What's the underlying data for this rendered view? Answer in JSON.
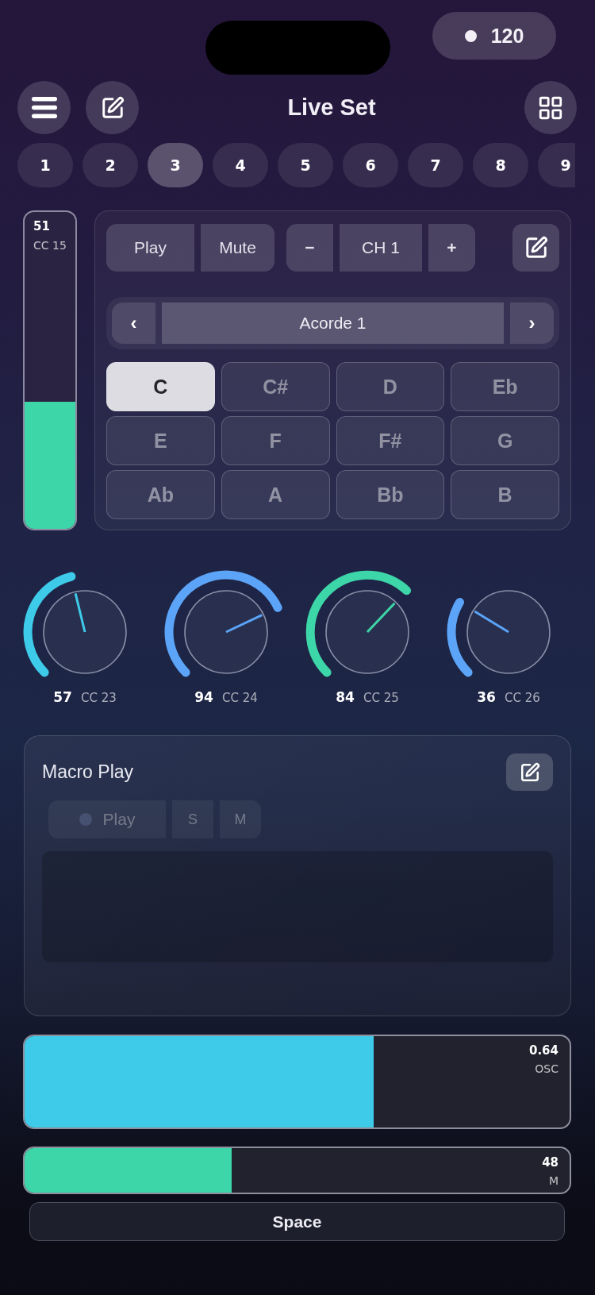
{
  "status_pill": {
    "text": "120"
  },
  "header": {
    "title": "Live Set"
  },
  "scene_tabs": [
    {
      "label": "1",
      "selected": false
    },
    {
      "label": "2",
      "selected": false
    },
    {
      "label": "3",
      "selected": true
    },
    {
      "label": "4",
      "selected": false
    },
    {
      "label": "5",
      "selected": false
    },
    {
      "label": "6",
      "selected": false
    },
    {
      "label": "7",
      "selected": false
    },
    {
      "label": "8",
      "selected": false
    },
    {
      "label": "9",
      "selected": false
    }
  ],
  "side_fader": {
    "value": "51",
    "label": "CC 15",
    "level": 0.4
  },
  "channel_panel": {
    "buttons": [
      {
        "label": "Play"
      },
      {
        "label": "Mute"
      }
    ],
    "channel_stepper": {
      "decrease": "−",
      "value": "CH 1",
      "increase": "+"
    },
    "preset": {
      "previous": "‹",
      "name": "Acorde 1",
      "next": "›"
    },
    "notes": [
      {
        "label": "C",
        "selected": true
      },
      {
        "label": "C#",
        "selected": false
      },
      {
        "label": "D",
        "selected": false
      },
      {
        "label": "Eb",
        "selected": false
      },
      {
        "label": "E",
        "selected": false
      },
      {
        "label": "F",
        "selected": false
      },
      {
        "label": "F#",
        "selected": false
      },
      {
        "label": "G",
        "selected": false
      },
      {
        "label": "Ab",
        "selected": false
      },
      {
        "label": "A",
        "selected": false
      },
      {
        "label": "Bb",
        "selected": false
      },
      {
        "label": "B",
        "selected": false
      }
    ]
  },
  "knobs": [
    {
      "value": "57",
      "label": "CC 23",
      "level": 0.449,
      "color": "#3ecbe9"
    },
    {
      "value": "94",
      "label": "CC 24",
      "level": 0.74,
      "color": "#5ba4f8"
    },
    {
      "value": "84",
      "label": "CC 25",
      "level": 0.661,
      "color": "#3dd6a8"
    },
    {
      "value": "36",
      "label": "CC 26",
      "level": 0.283,
      "color": "#5ba4f8"
    }
  ],
  "macro": {
    "title": "Macro Play",
    "transport": [
      {
        "kind": "play",
        "label": "Play",
        "disabled": true
      },
      {
        "kind": "toggle",
        "label": "S",
        "disabled": true
      },
      {
        "kind": "toggle",
        "label": "M",
        "disabled": true
      }
    ]
  },
  "bars": [
    {
      "kind": "tall",
      "value": "0.64",
      "label": "OSC",
      "level": 0.64,
      "color": "#3ecbe9"
    },
    {
      "kind": "short",
      "value": "48",
      "label": "M",
      "level": 0.38,
      "color": "#3dd6a8"
    }
  ],
  "space_button": {
    "label": "Space"
  }
}
